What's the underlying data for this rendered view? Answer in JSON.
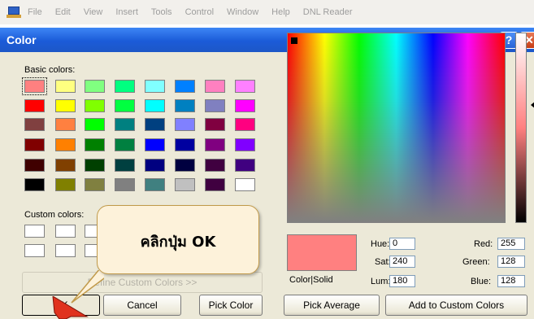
{
  "menubar": {
    "items": [
      "File",
      "Edit",
      "View",
      "Insert",
      "Tools",
      "Control",
      "Window",
      "Help",
      "DNL Reader"
    ]
  },
  "dialog": {
    "title": "Color",
    "help_glyph": "?",
    "close_glyph": "✕",
    "basic_colors_label": "Basic colors:",
    "basic_colors": [
      [
        "#ff8080",
        "#ffff80",
        "#80ff80",
        "#00ff80",
        "#80ffff",
        "#0080ff",
        "#ff80c0",
        "#ff80ff"
      ],
      [
        "#ff0000",
        "#ffff00",
        "#80ff00",
        "#00ff40",
        "#00ffff",
        "#0080c0",
        "#8080c0",
        "#ff00ff"
      ],
      [
        "#804040",
        "#ff8040",
        "#00ff00",
        "#008080",
        "#004080",
        "#8080ff",
        "#800040",
        "#ff0080"
      ],
      [
        "#800000",
        "#ff8000",
        "#008000",
        "#008040",
        "#0000ff",
        "#0000a0",
        "#800080",
        "#8000ff"
      ],
      [
        "#400000",
        "#804000",
        "#004000",
        "#004040",
        "#000080",
        "#000040",
        "#400040",
        "#400080"
      ],
      [
        "#000000",
        "#808000",
        "#808040",
        "#808080",
        "#408080",
        "#c0c0c0",
        "#400040",
        "#ffffff"
      ]
    ],
    "custom_colors_label": "Custom colors:",
    "define_custom_label": "Define Custom Colors >>",
    "ok_label": "OK",
    "cancel_label": "Cancel",
    "pick_color_label": "Pick Color",
    "pick_average_label": "Pick Average",
    "add_custom_label": "Add to Custom Colors",
    "color_solid_label": "Color|Solid",
    "preview_color": "#ff8080",
    "hue_label": "Hue:",
    "hue_value": "0",
    "sat_label": "Sat:",
    "sat_value": "240",
    "lum_label": "Lum:",
    "lum_value": "180",
    "red_label": "Red:",
    "red_value": "255",
    "green_label": "Green:",
    "green_value": "128",
    "blue_label": "Blue:",
    "blue_value": "128"
  },
  "callout": {
    "text": "คลิกปุ่ม OK"
  },
  "colors": {
    "titlebar": "#1b5bd8",
    "dialog_bg": "#ece9d8",
    "pointer": "#e0321e"
  }
}
